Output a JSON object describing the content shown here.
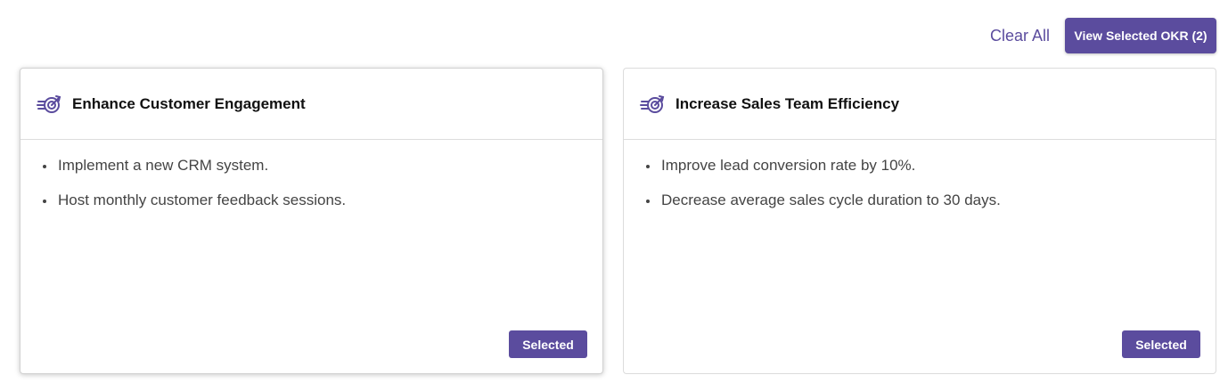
{
  "toolbar": {
    "clear_all_label": "Clear All",
    "view_selected_label": "View Selected OKR (2)"
  },
  "accent_color": "#5b4c9e",
  "cards": [
    {
      "title": "Enhance Customer Engagement",
      "icon": "target-arrow-icon",
      "key_results": [
        "Implement a new CRM system.",
        "Host monthly customer feedback sessions."
      ],
      "button_label": "Selected"
    },
    {
      "title": "Increase Sales Team Efficiency",
      "icon": "target-arrow-icon",
      "key_results": [
        "Improve lead conversion rate by 10%.",
        "Decrease average sales cycle duration to 30 days."
      ],
      "button_label": "Selected"
    }
  ]
}
